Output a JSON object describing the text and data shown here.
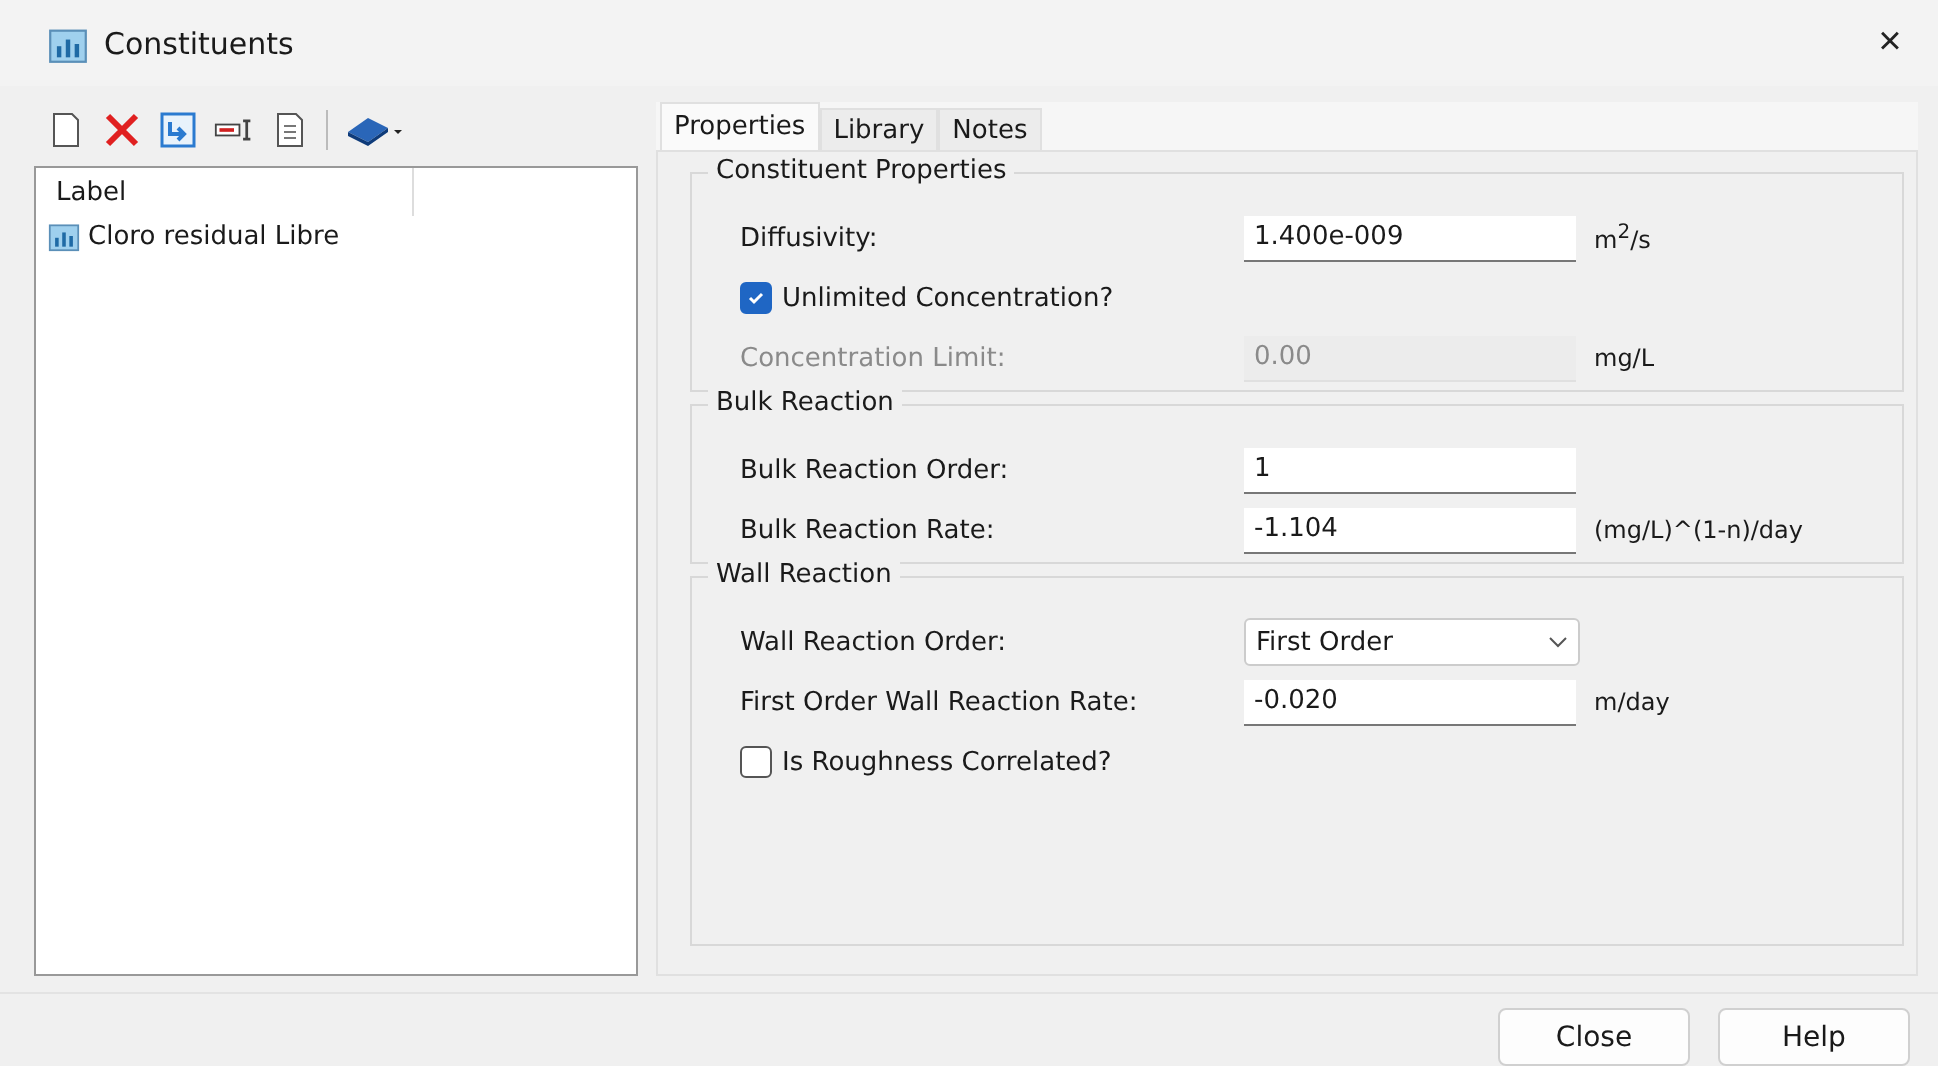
{
  "window": {
    "title": "Constituents",
    "close": "×"
  },
  "list": {
    "column": "Label",
    "items": [
      {
        "label": "Cloro residual Libre",
        "selected": false
      }
    ]
  },
  "tabs": [
    {
      "label": "Properties",
      "selected": true
    },
    {
      "label": "Library",
      "selected": false
    },
    {
      "label": "Notes",
      "selected": false
    }
  ],
  "groups": [
    {
      "title": "Constituent Properties",
      "rows": [
        {
          "kind": "field",
          "label": "Diffusivity:",
          "value": "1.400e-009",
          "unit": "m$^{2}$/s",
          "disabled": false
        },
        {
          "kind": "checkbox",
          "label": "Unlimited Concentration?",
          "checked": true
        },
        {
          "kind": "field",
          "label": "Concentration Limit:",
          "value": "0.00",
          "unit": "mg/L",
          "disabled": true
        }
      ]
    },
    {
      "title": "Bulk Reaction",
      "rows": [
        {
          "kind": "field",
          "label": "Bulk Reaction Order:",
          "value": "1",
          "disabled": false
        },
        {
          "kind": "field",
          "label": "Bulk Reaction Rate:",
          "value": "-1.104",
          "unit": "(mg/L)^(1-n)/day",
          "disabled": false
        }
      ]
    },
    {
      "title": "Wall Reaction",
      "rows": [
        {
          "kind": "dropdown",
          "label": "Wall Reaction Order:",
          "value": "First Order"
        },
        {
          "kind": "field",
          "label": "First Order Wall Reaction Rate:",
          "value": "-0.020",
          "unit": "m/day",
          "disabled": false
        },
        {
          "kind": "checkbox",
          "label": "Is Roughness Correlated?",
          "checked": false
        }
      ]
    }
  ],
  "buttons": [
    "Close",
    "Help"
  ]
}
